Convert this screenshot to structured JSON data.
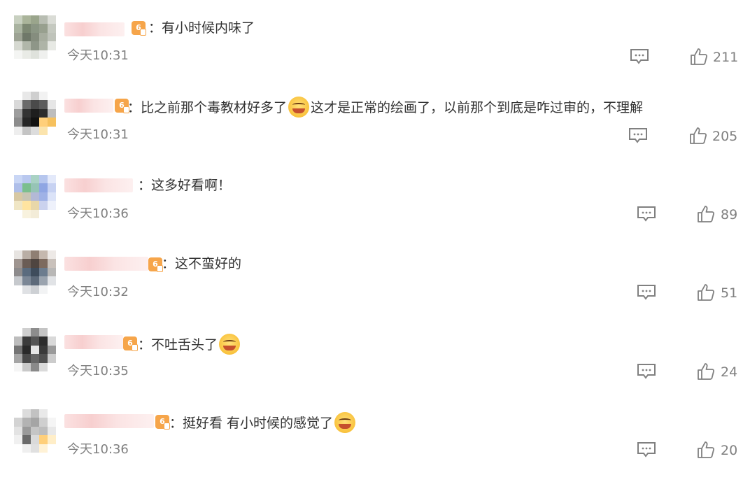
{
  "comments": [
    {
      "colon": "：",
      "text": "有小时候内味了",
      "badge_glyph": "6",
      "time": "今天10:31",
      "likes": "211",
      "emoji": null,
      "avatar_colors": [
        "#c8d0c0",
        "#aab49a",
        "#9aa58c",
        "#b8bdb2",
        "#dadcd6",
        "#a9b3a0",
        "#7d8873",
        "#8b9684",
        "#98a08f",
        "#c5c9c0",
        "#9da394",
        "#6f7869",
        "#858d7e",
        "#a7ad9f",
        "#bfc3ba",
        "#d6d9d1",
        "#b1b7aa",
        "#8e9688",
        "#aeb4a7",
        "#e7e9e4",
        "#f4f5f3",
        "#e9ebe6",
        "#dfe2dc",
        "#eff0ee",
        "#ffffff"
      ]
    },
    {
      "colon": "：",
      "text_before": "比之前那个毒教材好多了",
      "text_after": "这才是正常的绘画了，以前那个到底是咋过审的，不理解",
      "badge_glyph": "6",
      "time": "今天10:31",
      "likes": "205",
      "emoji": "laughing-tears",
      "avatar_colors": [
        "#ffffff",
        "#e8e8e8",
        "#cfcfcf",
        "#f2f2f2",
        "#ffffff",
        "#d9d9d9",
        "#6a6a6a",
        "#4a4a4a",
        "#5c5c5c",
        "#e6e6e6",
        "#9d9d9d",
        "#333333",
        "#1e1e1e",
        "#2c2c2c",
        "#bdbdbd",
        "#8c8c8c",
        "#262626",
        "#121212",
        "#ffcf7a",
        "#f6c15e",
        "#eeeeee",
        "#c4c4c4",
        "#dcdcdc",
        "#fbe4ad",
        "#ffffff"
      ]
    },
    {
      "colon": "：",
      "text": "这多好看啊！",
      "badge_glyph": "",
      "time": "今天10:36",
      "likes": "89",
      "emoji": null,
      "avatar_colors": [
        "#c9d6f5",
        "#b9c8ef",
        "#a9d2c4",
        "#b6c6ee",
        "#e3e9fa",
        "#aebee9",
        "#7bbf8e",
        "#96c4b6",
        "#8fa6e3",
        "#c7d2f2",
        "#d7c8a3",
        "#c8c5b3",
        "#b3b9d6",
        "#9fb2e6",
        "#dbe3f8",
        "#f0e6c5",
        "#ffe4a0",
        "#e8d7a9",
        "#cbd2ee",
        "#eef1fb",
        "#ffffff",
        "#f8f2de",
        "#f3ecd8",
        "#ffffff",
        "#ffffff"
      ]
    },
    {
      "colon": "：",
      "text": "这不蛮好的",
      "badge_glyph": "6",
      "time": "今天10:32",
      "likes": "51",
      "emoji": null,
      "avatar_colors": [
        "#e7e4e1",
        "#b9aea5",
        "#8f7f73",
        "#c5b8ae",
        "#ede9e6",
        "#9f9590",
        "#6a5c55",
        "#4f4540",
        "#7d6a5e",
        "#c9c1bb",
        "#8d8b8c",
        "#5a6b7e",
        "#3e4c5c",
        "#6c7c8e",
        "#b8b7b6",
        "#c6c9cd",
        "#7b8796",
        "#5d6a7a",
        "#9aa3ae",
        "#e1e3e6",
        "#ffffff",
        "#dfe1e4",
        "#cdd0d4",
        "#f2f3f4",
        "#ffffff"
      ]
    },
    {
      "colon": "：",
      "text": "不吐舌头了",
      "badge_glyph": "6",
      "time": "今天10:35",
      "likes": "24",
      "emoji": "screaming",
      "avatar_colors": [
        "#ffffff",
        "#cfcfcf",
        "#8d8d8d",
        "#c4c4c4",
        "#ffffff",
        "#bdbdbd",
        "#3c3c3c",
        "#555555",
        "#2d2d2d",
        "#d9d9d9",
        "#747474",
        "#2a2a2a",
        "#e6e6e6",
        "#3a3a3a",
        "#9a9a9a",
        "#a5a5a5",
        "#4a4a4a",
        "#666666",
        "#505050",
        "#cccccc",
        "#f5f5f5",
        "#c9c9c9",
        "#8a8a8a",
        "#dadada",
        "#ffffff"
      ]
    },
    {
      "colon": "：",
      "text": "挺好看 有小时候的感觉了",
      "badge_glyph": "6",
      "time": "今天10:36",
      "likes": "20",
      "emoji": "flower-happy",
      "avatar_colors": [
        "#ffffff",
        "#dcdcdc",
        "#c2c2c2",
        "#e9e9e9",
        "#ffffff",
        "#d3d3d3",
        "#b3b3b3",
        "#a5a5a5",
        "#cfcfcf",
        "#f5f5f5",
        "#e3e3e3",
        "#9a9a9a",
        "#c5c5c5",
        "#bdbdbd",
        "#e8e8e8",
        "#f0f0f0",
        "#6a6a6a",
        "#dadada",
        "#ffcf7a",
        "#ffeec8",
        "#ffffff",
        "#efefef",
        "#e0e0e0",
        "#fff2d6",
        "#ffffff"
      ]
    }
  ],
  "colors": {
    "text": "#333333",
    "meta": "#808080",
    "badge": "#f6a54a"
  }
}
